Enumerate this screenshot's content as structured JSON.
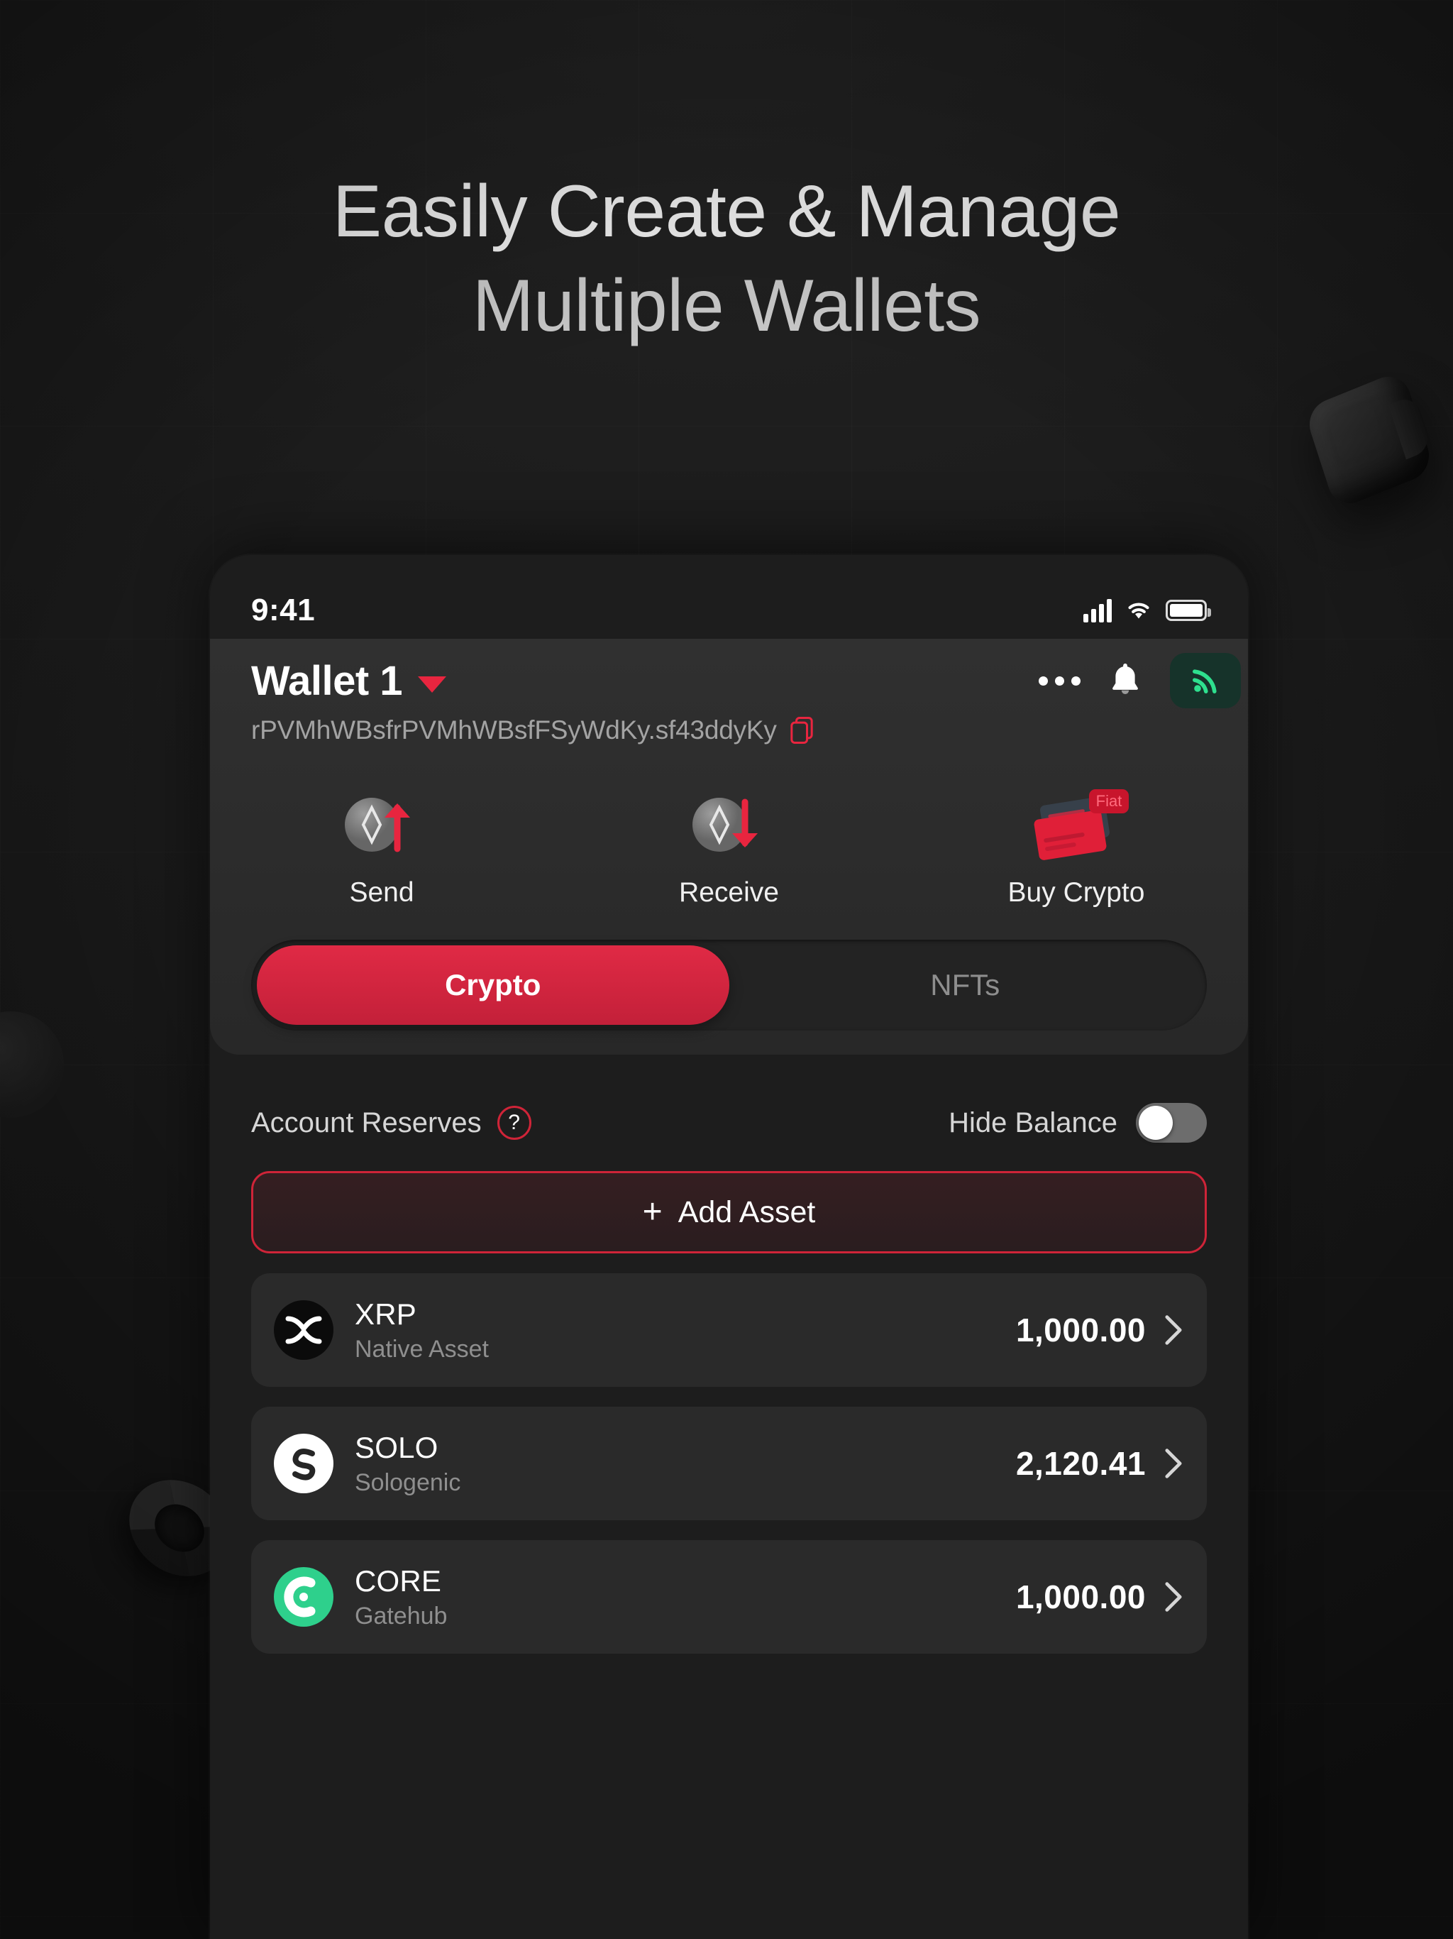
{
  "headline": {
    "line1": "Easily Create & Manage",
    "line2": "Multiple Wallets"
  },
  "statusbar": {
    "time": "9:41",
    "cellular_icon": "cellular-bars-icon",
    "wifi_icon": "wifi-icon",
    "battery_icon": "battery-full-icon"
  },
  "header": {
    "wallet_name": "Wallet 1",
    "dropdown_icon": "caret-down-icon",
    "address": "rPVMhWBsfrPVMhWBsfFSyWdKy.sf43ddyKy",
    "copy_icon": "copy-icon",
    "more_icon": "more-dots-icon",
    "bell_icon": "bell-icon",
    "signal_icon": "signal-broadcast-icon",
    "accent_red": "#e8253f",
    "accent_green": "#2ee08e"
  },
  "actions": [
    {
      "label": "Send",
      "icon": "send-coin-up-arrow-icon"
    },
    {
      "label": "Receive",
      "icon": "receive-coin-down-arrow-icon"
    },
    {
      "label": "Buy Crypto",
      "icon": "credit-card-fiat-icon",
      "badge": "Fiat"
    }
  ],
  "tabs": [
    {
      "label": "Crypto",
      "active": true
    },
    {
      "label": "NFTs",
      "active": false
    }
  ],
  "reserves": {
    "label": "Account Reserves",
    "help_icon": "question-mark-icon",
    "help_glyph": "?"
  },
  "hide_balance": {
    "label": "Hide Balance",
    "enabled": false
  },
  "add_asset": {
    "label": "Add Asset",
    "plus_glyph": "+"
  },
  "assets": [
    {
      "symbol": "XRP",
      "issuer": "Native Asset",
      "balance": "1,000.00",
      "icon": "xrp-logo-icon",
      "icon_bg": "#0b0b0b",
      "chevron": "chevron-right-icon"
    },
    {
      "symbol": "SOLO",
      "issuer": "Sologenic",
      "balance": "2,120.41",
      "icon": "solo-logo-icon",
      "icon_bg": "#ffffff",
      "chevron": "chevron-right-icon"
    },
    {
      "symbol": "CORE",
      "issuer": "Gatehub",
      "balance": "1,000.00",
      "icon": "core-logo-icon",
      "icon_bg": "#2ed08c",
      "chevron": "chevron-right-icon"
    }
  ]
}
